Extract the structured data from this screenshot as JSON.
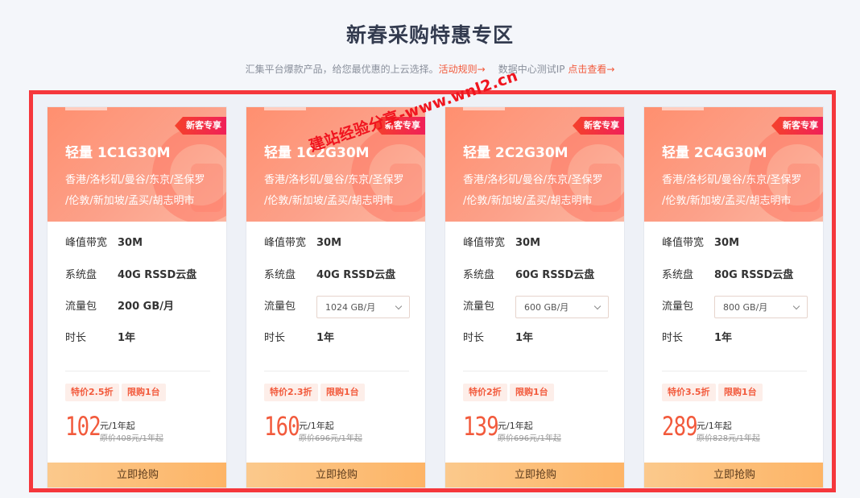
{
  "header": {
    "title": "新春采购特惠专区",
    "subtitle_text": "汇集平台爆款产品，给您最优惠的上云选择。",
    "rules_link": "活动规则→",
    "dc_text": "数据中心测试IP",
    "dc_link": "点击查看→"
  },
  "labels": {
    "badge": "新客专享",
    "regions_line1": "香港/洛杉矶/曼谷/东京/圣保罗",
    "regions_line2": "/伦敦/新加坡/孟买/胡志明市",
    "bandwidth": "峰值带宽",
    "disk": "系统盘",
    "traffic": "流量包",
    "duration": "时长",
    "price_unit": "元/1年起",
    "buy_button": "立即抢购",
    "limit_tag": "限购1台"
  },
  "cards": [
    {
      "name": "轻量 1C1G30M",
      "bandwidth": "30M",
      "disk": "40G RSSD云盘",
      "traffic": "200 GB/月",
      "duration": "1年",
      "discount": "特价2.5折",
      "price": "102",
      "original": "原价408元/1年起"
    },
    {
      "name": "轻量 1C2G30M",
      "bandwidth": "30M",
      "disk": "40G RSSD云盘",
      "traffic": "1024 GB/月",
      "duration": "1年",
      "discount": "特价2.3折",
      "price": "160",
      "original": "原价696元/1年起"
    },
    {
      "name": "轻量 2C2G30M",
      "bandwidth": "30M",
      "disk": "60G RSSD云盘",
      "traffic": "600 GB/月",
      "duration": "1年",
      "discount": "特价2折",
      "price": "139",
      "original": "原价696元/1年起"
    },
    {
      "name": "轻量 2C4G30M",
      "bandwidth": "30M",
      "disk": "80G RSSD云盘",
      "traffic": "800 GB/月",
      "duration": "1年",
      "discount": "特价3.5折",
      "price": "289",
      "original": "原价828元/1年起"
    }
  ],
  "watermark": "建站经验分享-www.wnl2.cn",
  "colors": {
    "accent": "#f25a3c",
    "frame": "#f5373c",
    "button": "#fdb466"
  }
}
